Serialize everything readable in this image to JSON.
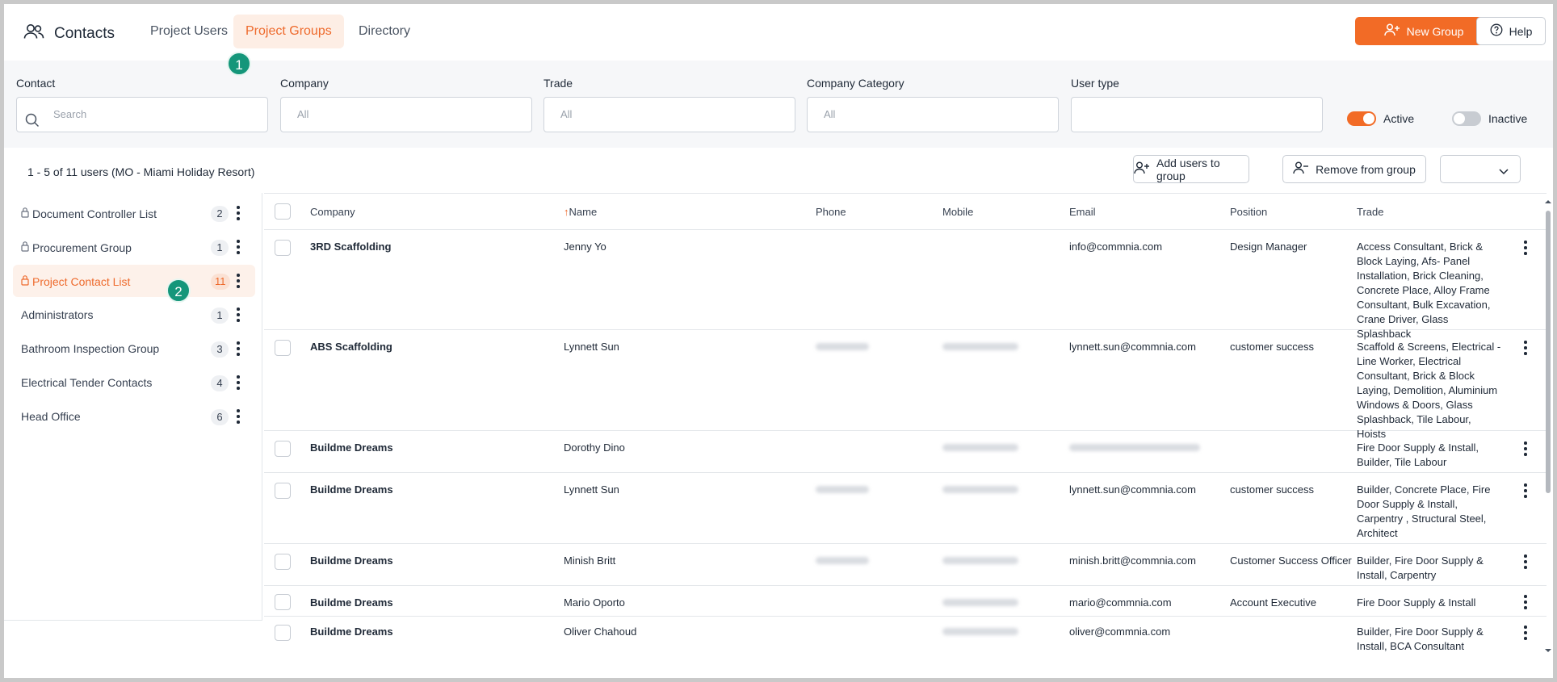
{
  "header": {
    "title": "Contacts",
    "tabs": [
      {
        "label": "Project Users"
      },
      {
        "label": "Project Groups"
      },
      {
        "label": "Directory"
      }
    ],
    "new_group_label": "New Group",
    "help_label": "Help",
    "step1": "1",
    "step2": "2"
  },
  "filters": {
    "contact_label": "Contact",
    "contact_placeholder": "Search",
    "company_label": "Company",
    "company_value": "All",
    "trade_label": "Trade",
    "trade_value": "All",
    "category_label": "Company Category",
    "category_value": "All",
    "usertype_label": "User type",
    "active_label": "Active",
    "inactive_label": "Inactive"
  },
  "summary": {
    "text": "1 - 5 of 11 users (MO - Miami Holiday Resort)",
    "add_users_label": "Add users to group",
    "remove_label": "Remove from group"
  },
  "groups": [
    {
      "label": "Document Controller List",
      "count": "2"
    },
    {
      "label": "Procurement Group",
      "count": "1"
    },
    {
      "label": "Project Contact List",
      "count": "11"
    },
    {
      "label": "Administrators",
      "count": "1"
    },
    {
      "label": "Bathroom Inspection Group",
      "count": "3"
    },
    {
      "label": "Electrical Tender Contacts",
      "count": "4"
    },
    {
      "label": "Head Office",
      "count": "6"
    }
  ],
  "table": {
    "columns": [
      "Company",
      "Name",
      "Phone",
      "Mobile",
      "Email",
      "Position",
      "Trade"
    ],
    "sort_arrow": "↑",
    "rows": [
      {
        "company": "3RD Scaffolding",
        "name": "Jenny Yo",
        "email": "info@commnia.com",
        "position": "Design Manager",
        "trade": "Access Consultant, Brick & Block Laying, Afs- Panel Installation, Brick Cleaning, Concrete Place, Alloy Frame Consultant, Bulk Excavation, Crane Driver, Glass Splashback"
      },
      {
        "company": "ABS Scaffolding",
        "name": "Lynnett Sun",
        "email": "lynnett.sun@commnia.com",
        "position": "customer success",
        "trade": "Scaffold & Screens, Electrical - Line Worker, Electrical Consultant, Brick & Block Laying, Demolition, Aluminium Windows & Doors, Glass Splashback, Tile Labour, Hoists"
      },
      {
        "company": "Buildme Dreams",
        "name": "Dorothy Dino",
        "email": "",
        "position": "",
        "trade": "Fire Door Supply & Install, Builder, Tile Labour"
      },
      {
        "company": "Buildme Dreams",
        "name": "Lynnett Sun",
        "email": "lynnett.sun@commnia.com",
        "position": "customer success",
        "trade": "Builder, Concrete Place, Fire Door Supply & Install, Carpentry , Structural Steel, Architect"
      },
      {
        "company": "Buildme Dreams",
        "name": "Minish Britt",
        "email": "minish.britt@commnia.com",
        "position": "Customer Success Officer",
        "trade": "Builder, Fire Door Supply & Install, Carpentry"
      },
      {
        "company": "Buildme Dreams",
        "name": "Mario Oporto",
        "email": "mario@commnia.com",
        "position": "Account Executive",
        "trade": "Fire Door Supply & Install"
      },
      {
        "company": "Buildme Dreams",
        "name": "Oliver Chahoud",
        "email": "oliver@commnia.com",
        "position": "",
        "trade": "Builder, Fire Door Supply & Install, BCA Consultant"
      }
    ]
  },
  "colors": {
    "accent": "#f26b26",
    "step": "#15967a"
  }
}
